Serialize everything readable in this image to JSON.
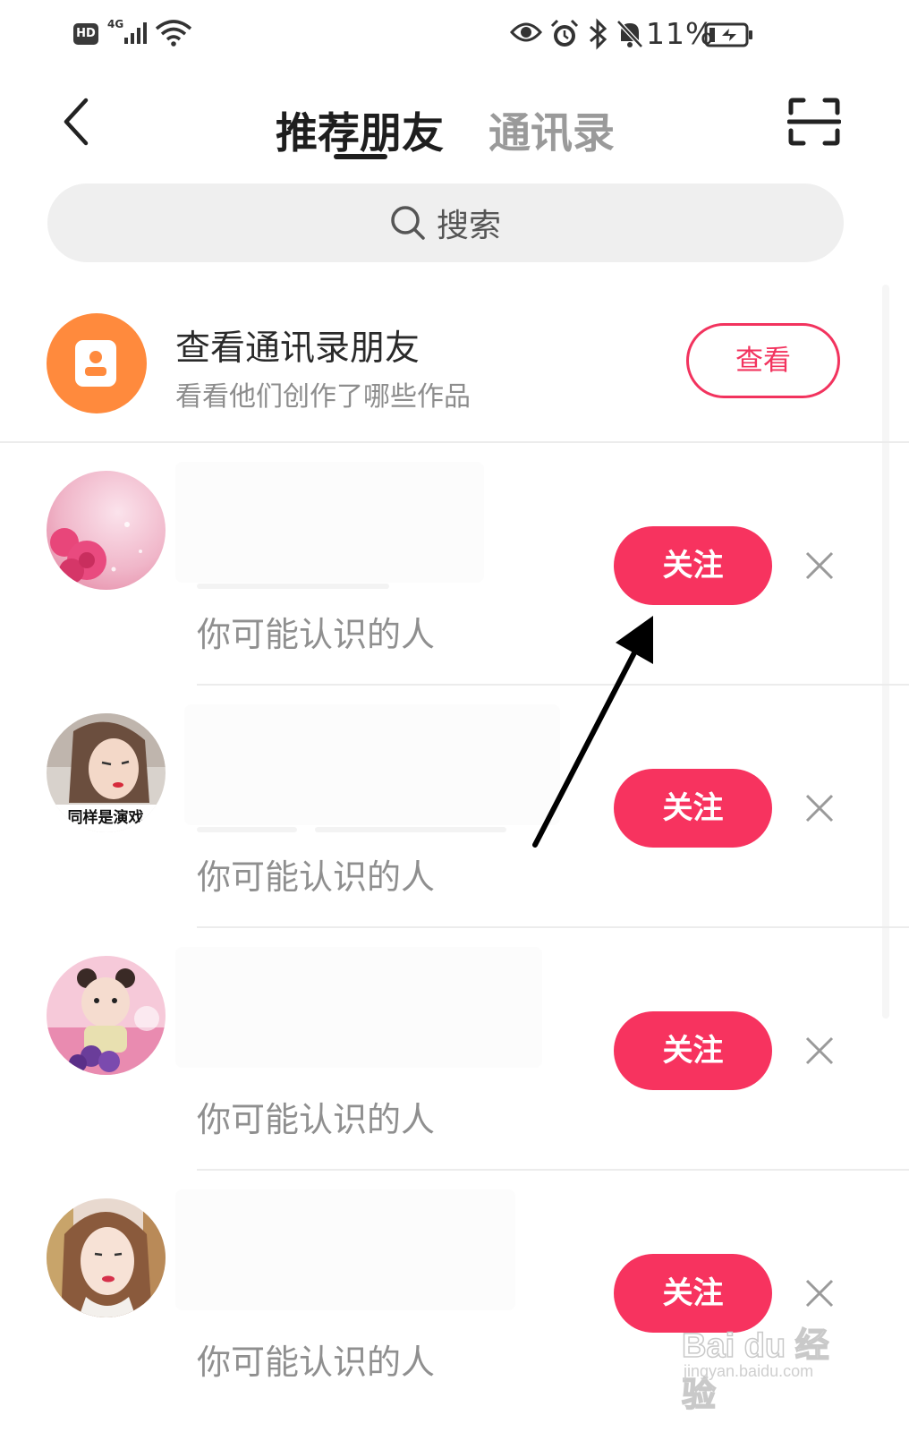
{
  "status_bar": {
    "hd_badge": "HD",
    "network_label": "4G",
    "battery_percent": "11%",
    "icons": [
      "signal-icon",
      "wifi-icon",
      "eye-icon",
      "alarm-icon",
      "bluetooth-icon",
      "mute-bell-icon",
      "battery-charging-icon"
    ]
  },
  "header": {
    "tabs": [
      {
        "label": "推荐朋友",
        "active": true
      },
      {
        "label": "通讯录",
        "active": false
      }
    ],
    "back_icon": "chevron-left-icon",
    "scan_icon": "scan-frame-icon"
  },
  "search": {
    "placeholder": "搜索",
    "icon": "search-icon"
  },
  "contacts_card": {
    "title": "查看通讯录朋友",
    "subtitle": "看看他们创作了哪些作品",
    "button_label": "查看",
    "icon": "contact-book-icon",
    "icon_bg": "#ff8a3d"
  },
  "suggestions": [
    {
      "reason": "你可能认识的人",
      "follow_label": "关注",
      "avatar_caption": ""
    },
    {
      "reason": "你可能认识的人",
      "follow_label": "关注",
      "avatar_caption": "同样是演戏"
    },
    {
      "reason": "你可能认识的人",
      "follow_label": "关注",
      "avatar_caption": ""
    },
    {
      "reason": "你可能认识的人",
      "follow_label": "关注",
      "avatar_caption": ""
    }
  ],
  "colors": {
    "accent": "#f7335f",
    "active_tab": "#1e1e1e",
    "inactive_tab": "#9a9a9a"
  },
  "watermark": {
    "brand": "Bai du 经验",
    "url": "jingyan.baidu.com"
  }
}
